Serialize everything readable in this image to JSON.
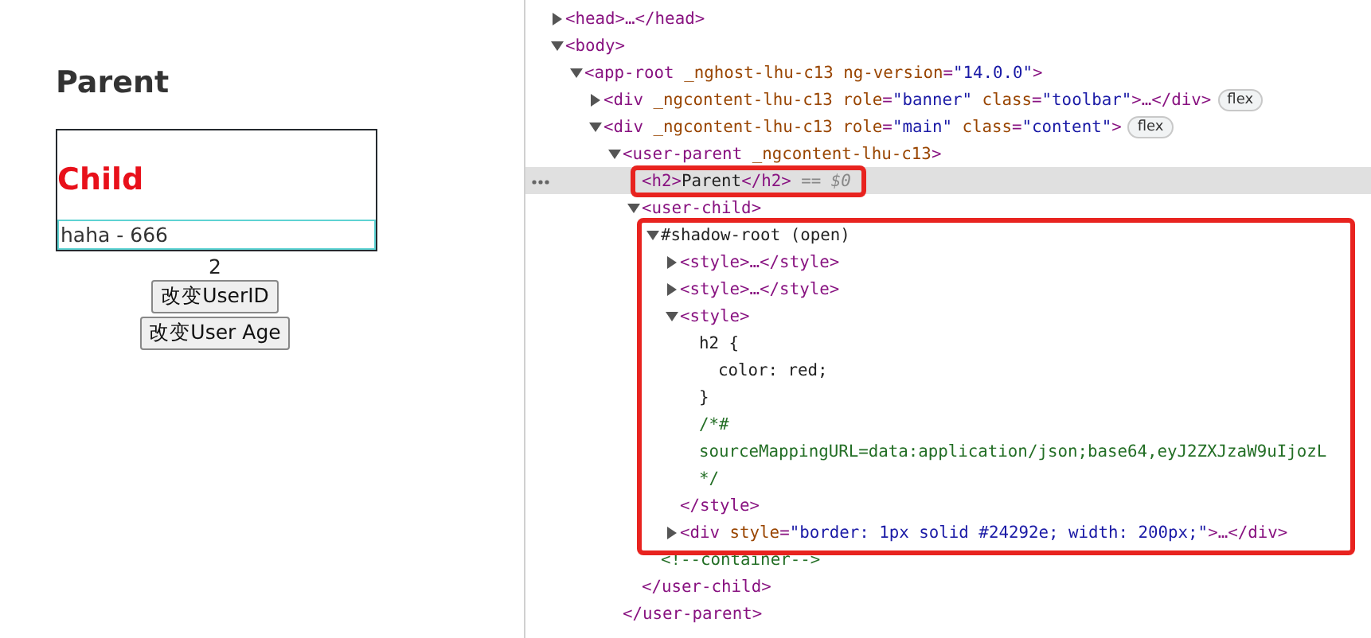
{
  "preview": {
    "heading": "Parent",
    "child_heading": "Child",
    "input_value": "haha - 666",
    "count": "2",
    "buttons": [
      "改变UserID",
      "改变User Age"
    ]
  },
  "devtools": {
    "nodes": [
      {
        "expanded": false,
        "selected": false,
        "segments": [
          {
            "kind": "tag",
            "text": "<head>…</head>"
          }
        ]
      },
      {
        "expanded": true,
        "selected": false,
        "segments": [
          {
            "kind": "tag",
            "text": "<body>"
          }
        ],
        "children": [
          {
            "expanded": true,
            "selected": false,
            "segments": [
              {
                "kind": "tag",
                "text": "<app-root "
              },
              {
                "kind": "attr",
                "text": "_nghost-lhu-c13 "
              },
              {
                "kind": "attr",
                "text": "ng-version"
              },
              {
                "kind": "tag",
                "text": "="
              },
              {
                "kind": "value",
                "text": "\"14.0.0\""
              },
              {
                "kind": "tag",
                "text": ">"
              }
            ],
            "children": [
              {
                "expanded": false,
                "selected": false,
                "badge": "flex",
                "segments": [
                  {
                    "kind": "tag",
                    "text": "<div "
                  },
                  {
                    "kind": "attr",
                    "text": "_ngcontent-lhu-c13 "
                  },
                  {
                    "kind": "attr",
                    "text": "role"
                  },
                  {
                    "kind": "tag",
                    "text": "="
                  },
                  {
                    "kind": "value",
                    "text": "\"banner\" "
                  },
                  {
                    "kind": "attr",
                    "text": "class"
                  },
                  {
                    "kind": "tag",
                    "text": "="
                  },
                  {
                    "kind": "value",
                    "text": "\"toolbar\""
                  },
                  {
                    "kind": "tag",
                    "text": ">…</div>"
                  }
                ]
              },
              {
                "expanded": true,
                "selected": false,
                "badge": "flex",
                "segments": [
                  {
                    "kind": "tag",
                    "text": "<div "
                  },
                  {
                    "kind": "attr",
                    "text": "_ngcontent-lhu-c13 "
                  },
                  {
                    "kind": "attr",
                    "text": "role"
                  },
                  {
                    "kind": "tag",
                    "text": "="
                  },
                  {
                    "kind": "value",
                    "text": "\"main\" "
                  },
                  {
                    "kind": "attr",
                    "text": "class"
                  },
                  {
                    "kind": "tag",
                    "text": "="
                  },
                  {
                    "kind": "value",
                    "text": "\"content\""
                  },
                  {
                    "kind": "tag",
                    "text": ">"
                  }
                ],
                "children": [
                  {
                    "expanded": true,
                    "selected": false,
                    "segments": [
                      {
                        "kind": "tag",
                        "text": "<user-parent "
                      },
                      {
                        "kind": "attr",
                        "text": "_ngcontent-lhu-c13"
                      },
                      {
                        "kind": "tag",
                        "text": ">"
                      }
                    ],
                    "children": [
                      {
                        "selected": true,
                        "framed": true,
                        "segments": [
                          {
                            "kind": "tag",
                            "text": "<h2>"
                          },
                          {
                            "kind": "text",
                            "text": "Parent"
                          },
                          {
                            "kind": "tag",
                            "text": "</h2>"
                          },
                          {
                            "kind": "hint",
                            "text": " == $0"
                          }
                        ]
                      },
                      {
                        "expanded": true,
                        "selected": false,
                        "segments": [
                          {
                            "kind": "tag",
                            "text": "<user-child>"
                          }
                        ],
                        "children": [
                          {
                            "expanded": true,
                            "selected": false,
                            "framed": true,
                            "segments": [
                              {
                                "kind": "text",
                                "text": "#shadow-root (open)"
                              }
                            ],
                            "children": [
                              {
                                "expanded": false,
                                "selected": false,
                                "segments": [
                                  {
                                    "kind": "tag",
                                    "text": "<style>…</style>"
                                  }
                                ]
                              },
                              {
                                "expanded": false,
                                "selected": false,
                                "segments": [
                                  {
                                    "kind": "tag",
                                    "text": "<style>…</style>"
                                  }
                                ]
                              },
                              {
                                "expanded": true,
                                "selected": false,
                                "segments": [
                                  {
                                    "kind": "tag",
                                    "text": "<style>"
                                  }
                                ],
                                "children": [
                                  {
                                    "selected": false,
                                    "segments": [
                                      {
                                        "kind": "css",
                                        "text": "h2 {"
                                      }
                                    ],
                                    "children": [
                                      {
                                        "selected": false,
                                        "segments": [
                                          {
                                            "kind": "css",
                                            "text": "color: red;"
                                          }
                                        ]
                                      }
                                    ],
                                    "closing": [
                                      {
                                        "kind": "css",
                                        "text": "}"
                                      }
                                    ]
                                  },
                                  {
                                    "selected": false,
                                    "segments": [
                                      {
                                        "kind": "comment",
                                        "text": "/*#"
                                      }
                                    ]
                                  },
                                  {
                                    "selected": false,
                                    "segments": [
                                      {
                                        "kind": "comment",
                                        "text": "sourceMappingURL=data:application/json;base64,eyJ2ZXJzaW9uIjozL"
                                      }
                                    ]
                                  },
                                  {
                                    "selected": false,
                                    "segments": [
                                      {
                                        "kind": "comment",
                                        "text": "*/"
                                      }
                                    ]
                                  }
                                ],
                                "closing": [
                                  {
                                    "kind": "tag",
                                    "text": "</style>"
                                  }
                                ]
                              },
                              {
                                "expanded": false,
                                "selected": false,
                                "segments": [
                                  {
                                    "kind": "tag",
                                    "text": "<div "
                                  },
                                  {
                                    "kind": "attr",
                                    "text": "style"
                                  },
                                  {
                                    "kind": "tag",
                                    "text": "="
                                  },
                                  {
                                    "kind": "value",
                                    "text": "\"border: 1px solid #24292e; width: 200px;\""
                                  },
                                  {
                                    "kind": "tag",
                                    "text": ">…</div>"
                                  }
                                ]
                              }
                            ]
                          },
                          {
                            "selected": false,
                            "segments": [
                              {
                                "kind": "comment",
                                "text": "<!--container-->"
                              }
                            ]
                          }
                        ],
                        "closing": [
                          {
                            "kind": "tag",
                            "text": "</user-child>"
                          }
                        ]
                      }
                    ],
                    "closing": [
                      {
                        "kind": "tag",
                        "text": "</user-parent>"
                      }
                    ]
                  }
                ]
              }
            ]
          }
        ]
      }
    ]
  }
}
